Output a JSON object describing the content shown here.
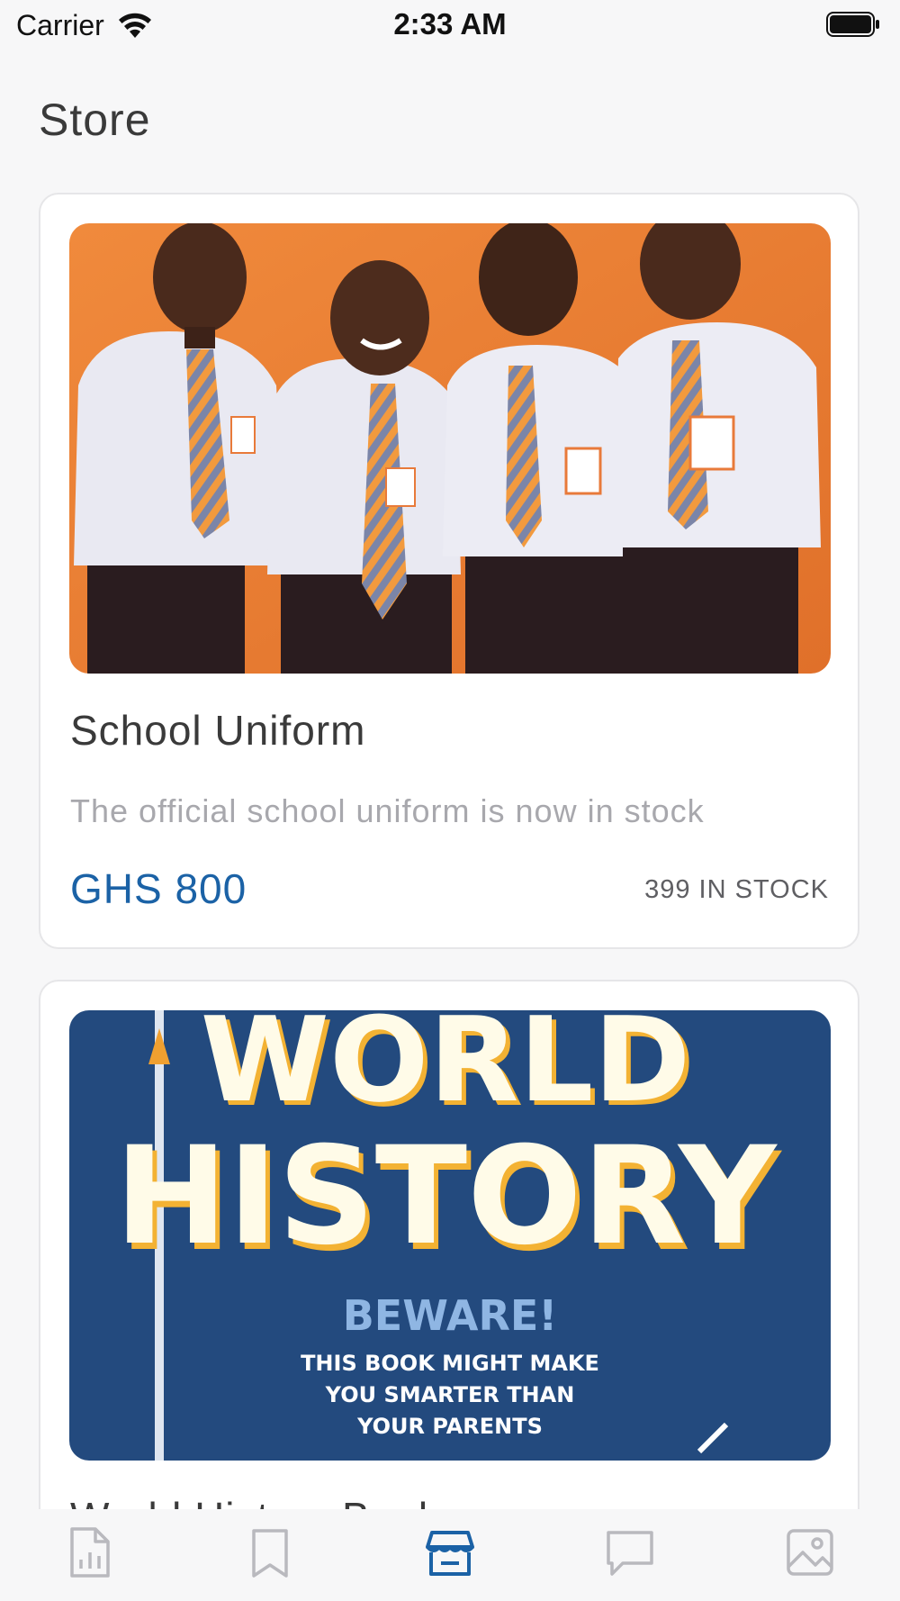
{
  "status_bar": {
    "carrier": "Carrier",
    "time": "2:33 AM"
  },
  "header": {
    "title": "Store"
  },
  "products": [
    {
      "title": "School Uniform",
      "description": "The official school uniform is now in stock",
      "price": "GHS 800",
      "stock": "399 IN STOCK",
      "image": "students-in-uniform-photo"
    },
    {
      "title": "World History Book",
      "image": "world-history-book-cover",
      "cover_title_line1": "WORLD",
      "cover_title_line2": "HISTORY",
      "cover_line1": "BEWARE!",
      "cover_line2": "THIS BOOK MIGHT MAKE",
      "cover_line3": "YOU SMARTER THAN",
      "cover_line4": "YOUR PARENTS"
    }
  ],
  "tab_bar": {
    "tabs": [
      {
        "icon": "report-icon",
        "active": false
      },
      {
        "icon": "bookmark-icon",
        "active": false
      },
      {
        "icon": "store-icon",
        "active": true
      },
      {
        "icon": "chat-icon",
        "active": false
      },
      {
        "icon": "gallery-icon",
        "active": false
      }
    ]
  },
  "colors": {
    "accent": "#1b62a6",
    "inactive_tab": "#b9b9be",
    "background": "#f7f7f8"
  }
}
